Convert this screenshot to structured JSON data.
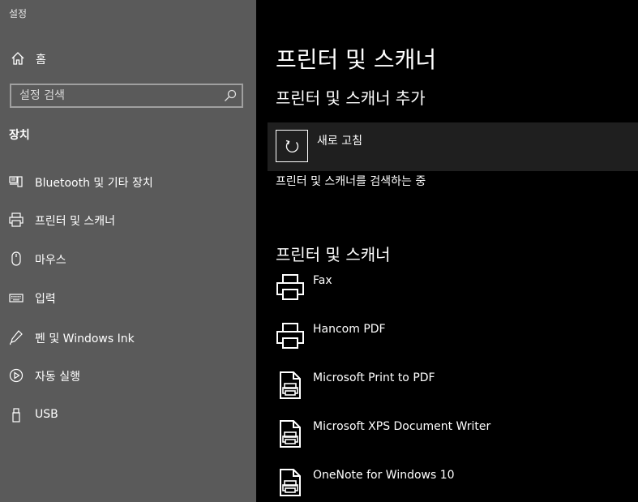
{
  "app_title": "설정",
  "sidebar": {
    "home_label": "홈",
    "search_placeholder": "설정 검색",
    "section": "장치",
    "items": [
      {
        "label": "Bluetooth 및 기타 장치",
        "icon": "bluetooth-devices-icon"
      },
      {
        "label": "프린터 및 스캐너",
        "icon": "printer-icon"
      },
      {
        "label": "마우스",
        "icon": "mouse-icon"
      },
      {
        "label": "입력",
        "icon": "keyboard-icon"
      },
      {
        "label": "펜 및 Windows Ink",
        "icon": "pen-icon"
      },
      {
        "label": "자동 실행",
        "icon": "autoplay-icon"
      },
      {
        "label": "USB",
        "icon": "usb-icon"
      }
    ]
  },
  "main": {
    "title": "프린터 및 스캐너",
    "add_heading": "프린터 및 스캐너 추가",
    "refresh_label": "새로 고침",
    "searching_text": "프린터 및 스캐너를 검색하는 중",
    "list_heading": "프린터 및 스캐너",
    "printers": [
      {
        "name": "Fax",
        "icon": "printer-icon"
      },
      {
        "name": "Hancom PDF",
        "icon": "printer-icon"
      },
      {
        "name": "Microsoft Print to PDF",
        "icon": "document-printer-icon"
      },
      {
        "name": "Microsoft XPS Document Writer",
        "icon": "document-printer-icon"
      },
      {
        "name": "OneNote for Windows 10",
        "icon": "document-printer-icon"
      }
    ]
  }
}
